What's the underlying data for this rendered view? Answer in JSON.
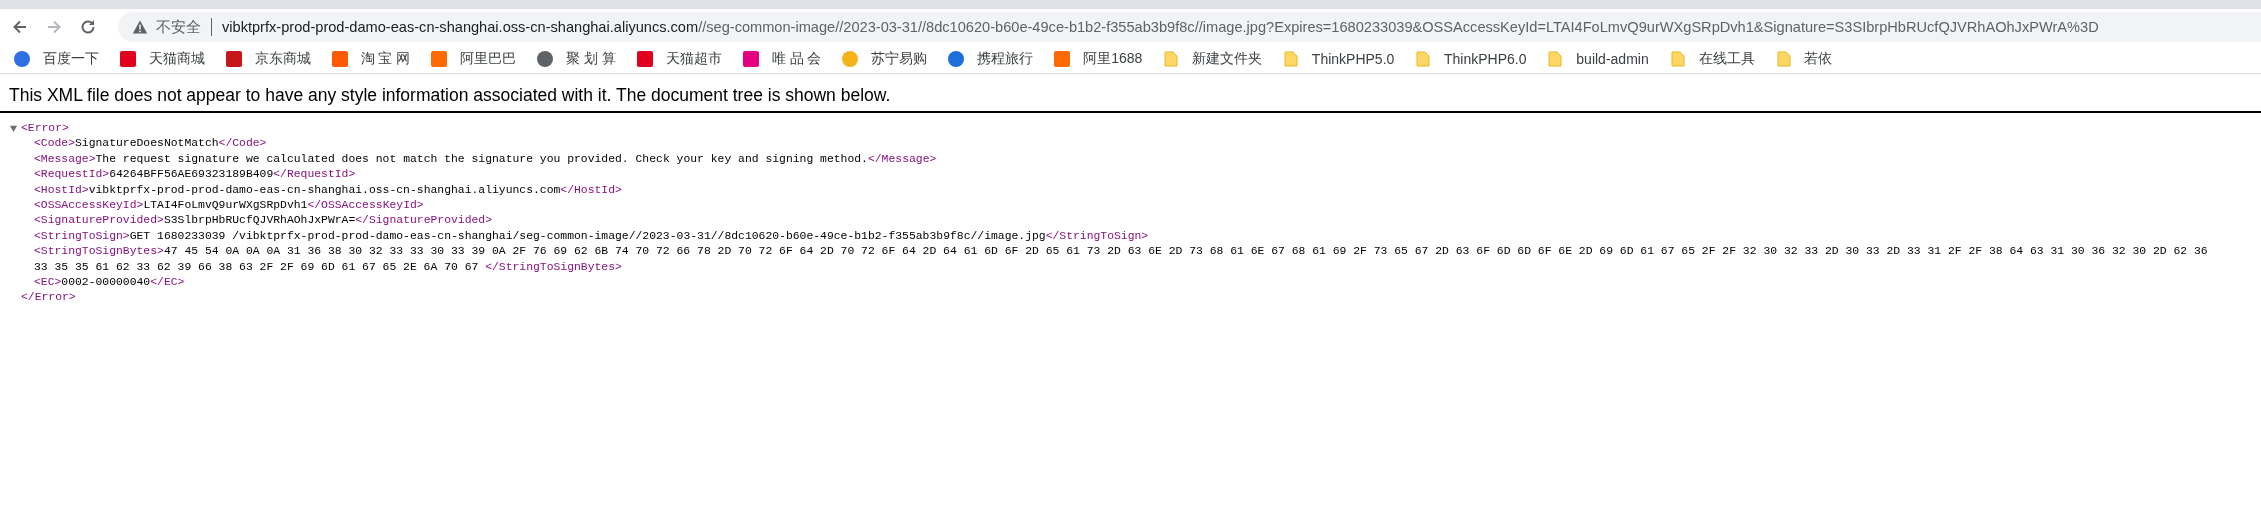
{
  "toolbar": {
    "security_label": "不安全",
    "url_host": "vibktprfx-prod-prod-damo-eas-cn-shanghai.oss-cn-shanghai.aliyuncs.com",
    "url_path": "//seg-common-image//2023-03-31//8dc10620-b60e-49ce-b1b2-f355ab3b9f8c//image.jpg?Expires=1680233039&OSSAccessKeyId=LTAI4FoLmvQ9urWXgSRpDvh1&Signature=S3SIbrpHbRUcfQJVRhAOhJxPWrA%3D"
  },
  "bookmarks": [
    {
      "label": "百度一下",
      "kind": "circle",
      "color": "#2f6fe4"
    },
    {
      "label": "天猫商城",
      "kind": "square",
      "color": "#e1001d"
    },
    {
      "label": "京东商城",
      "kind": "square",
      "color": "#c8161d"
    },
    {
      "label": "淘 宝 网",
      "kind": "square",
      "color": "#ff5a00"
    },
    {
      "label": "阿里巴巴",
      "kind": "square",
      "color": "#ff6a00"
    },
    {
      "label": "聚 划 算",
      "kind": "circle",
      "color": "#5f6368"
    },
    {
      "label": "天猫超市",
      "kind": "square",
      "color": "#e1001d"
    },
    {
      "label": "唯 品 会",
      "kind": "square",
      "color": "#e4007f"
    },
    {
      "label": "苏宁易购",
      "kind": "circle",
      "color": "#f5b21b"
    },
    {
      "label": "携程旅行",
      "kind": "circle",
      "color": "#1e6fd9"
    },
    {
      "label": "阿里1688",
      "kind": "square",
      "color": "#ff6a00"
    },
    {
      "label": "新建文件夹",
      "kind": "folder",
      "color": "#fdd663"
    },
    {
      "label": "ThinkPHP5.0",
      "kind": "folder",
      "color": "#fdd663"
    },
    {
      "label": "ThinkPHP6.0",
      "kind": "folder",
      "color": "#fdd663"
    },
    {
      "label": "build-admin",
      "kind": "folder",
      "color": "#fdd663"
    },
    {
      "label": "在线工具",
      "kind": "folder",
      "color": "#fdd663"
    },
    {
      "label": "若依",
      "kind": "folder",
      "color": "#fdd663"
    }
  ],
  "notice": "This XML file does not appear to have any style information associated with it. The document tree is shown below.",
  "tree": {
    "open": "<Error>",
    "close": "</Error>",
    "expanded": true,
    "children": [
      {
        "open": "<Code>",
        "lines": [
          "SignatureDoesNotMatch"
        ],
        "close": "</Code>"
      },
      {
        "open": "<Message>",
        "lines": [
          "The request signature we calculated does not match the signature you provided. Check your key and signing method."
        ],
        "close": "</Message>"
      },
      {
        "open": "<RequestId>",
        "lines": [
          "64264BFF56AE69323189B409"
        ],
        "close": "</RequestId>"
      },
      {
        "open": "<HostId>",
        "lines": [
          "vibktprfx-prod-prod-damo-eas-cn-shanghai.oss-cn-shanghai.aliyuncs.com"
        ],
        "close": "</HostId>"
      },
      {
        "open": "<OSSAccessKeyId>",
        "lines": [
          "LTAI4FoLmvQ9urWXgSRpDvh1"
        ],
        "close": "</OSSAccessKeyId>"
      },
      {
        "open": "<SignatureProvided>",
        "lines": [
          "S3SlbrpHbRUcfQJVRhAOhJxPWrA="
        ],
        "close": "</SignatureProvided>"
      },
      {
        "open": "<StringToSign>",
        "lines": [
          "GET 1680233039 /vibktprfx-prod-prod-damo-eas-cn-shanghai/seg-common-image//2023-03-31//8dc10620-b60e-49ce-b1b2-f355ab3b9f8c//image.jpg"
        ],
        "close": "</StringToSign>"
      },
      {
        "open": "<StringToSignBytes>",
        "lines": [
          "47 45 54 0A 0A 0A 31 36 38 30 32 33 33 30 33 39 0A 2F 76 69 62 6B 74 70 72 66 78 2D 70 72 6F 64 2D 70 72 6F 64 2D 64 61 6D 6F 2D 65 61 73 2D 63 6E 2D 73 68 61 6E 67 68 61 69 2F 73 65 67 2D 63 6F 6D 6D 6F 6E 2D 69 6D 61 67 65 2F 2F 32 30 32 33 2D 30 33 2D 33 31 2F 2F 38 64 63 31 30 36 32 30 2D 62 36",
          "33 35 35 61 62 33 62 39 66 38 63 2F 2F 69 6D 61 67 65 2E 6A 70 67 "
        ],
        "close": "</StringToSignBytes>"
      },
      {
        "open": "<EC>",
        "lines": [
          "0002-00000040"
        ],
        "close": "</EC>"
      }
    ]
  }
}
